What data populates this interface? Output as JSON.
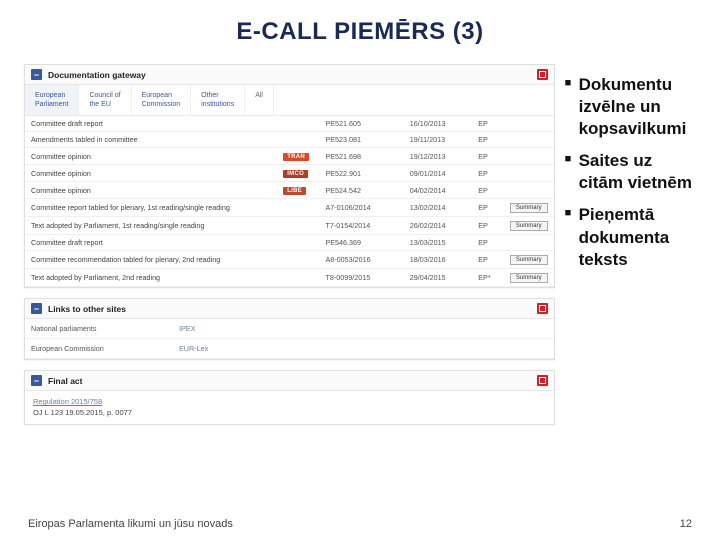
{
  "title": "E-CALL PIEMĒRS (3)",
  "panel1": {
    "title": "Documentation gateway"
  },
  "tabs": [
    {
      "label": "European\nParliament"
    },
    {
      "label": "Council of\nthe EU"
    },
    {
      "label": "European\nCommission"
    },
    {
      "label": "Other\ninstitutions"
    },
    {
      "label": "All"
    }
  ],
  "rows": [
    {
      "desc": "Committee draft report",
      "badge": "",
      "ref": "PE521.605",
      "date": "16/10/2013",
      "src": "EP",
      "summary": false
    },
    {
      "desc": "Amendments tabled in committee",
      "badge": "",
      "ref": "PE523.081",
      "date": "19/11/2013",
      "src": "EP",
      "summary": false
    },
    {
      "desc": "Committee opinion",
      "badge": "TRAN",
      "ref": "PE521.698",
      "date": "19/12/2013",
      "src": "EP",
      "summary": false
    },
    {
      "desc": "Committee opinion",
      "badge": "IMCO",
      "ref": "PE522.901",
      "date": "09/01/2014",
      "src": "EP",
      "summary": false
    },
    {
      "desc": "Committee opinion",
      "badge": "LIBE",
      "ref": "PE524.542",
      "date": "04/02/2014",
      "src": "EP",
      "summary": false
    },
    {
      "desc": "Committee report tabled for plenary, 1st reading/single reading",
      "badge": "",
      "ref": "A7-0106/2014",
      "date": "13/02/2014",
      "src": "EP",
      "summary": true
    },
    {
      "desc": "Text adopted by Parliament, 1st reading/single reading",
      "badge": "",
      "ref": "T7-0154/2014",
      "date": "26/02/2014",
      "src": "EP",
      "summary": true
    },
    {
      "desc": "Committee draft report",
      "badge": "",
      "ref": "PE546.369",
      "date": "13/03/2015",
      "src": "EP",
      "summary": false
    },
    {
      "desc": "Committee recommendation tabled for plenary, 2nd reading",
      "badge": "",
      "ref": "A8-0053/2016",
      "date": "18/03/2016",
      "src": "EP",
      "summary": true
    },
    {
      "desc": "Text adopted by Parliament, 2nd reading",
      "badge": "",
      "ref": "T8-0099/2015",
      "date": "29/04/2015",
      "src": "EP*",
      "summary": true
    }
  ],
  "panel2": {
    "title": "Links to other sites"
  },
  "links": [
    {
      "label": "National parliaments",
      "value": "IPEX"
    },
    {
      "label": "European Commission",
      "value": "EUR-Lex"
    }
  ],
  "panel3": {
    "title": "Final act"
  },
  "final": {
    "line1_link": "Regulation 2015/758",
    "line2": "OJ L 123 19.05.2015, p. 0077"
  },
  "bullets": [
    "Dokumentu izvēlne un kopsavilkumi",
    "Saites uz citām vietnēm",
    "Pieņemtā dokumenta teksts"
  ],
  "footer": {
    "left": "Eiropas Parlamenta likumi un jūsu novads",
    "right": "12"
  }
}
